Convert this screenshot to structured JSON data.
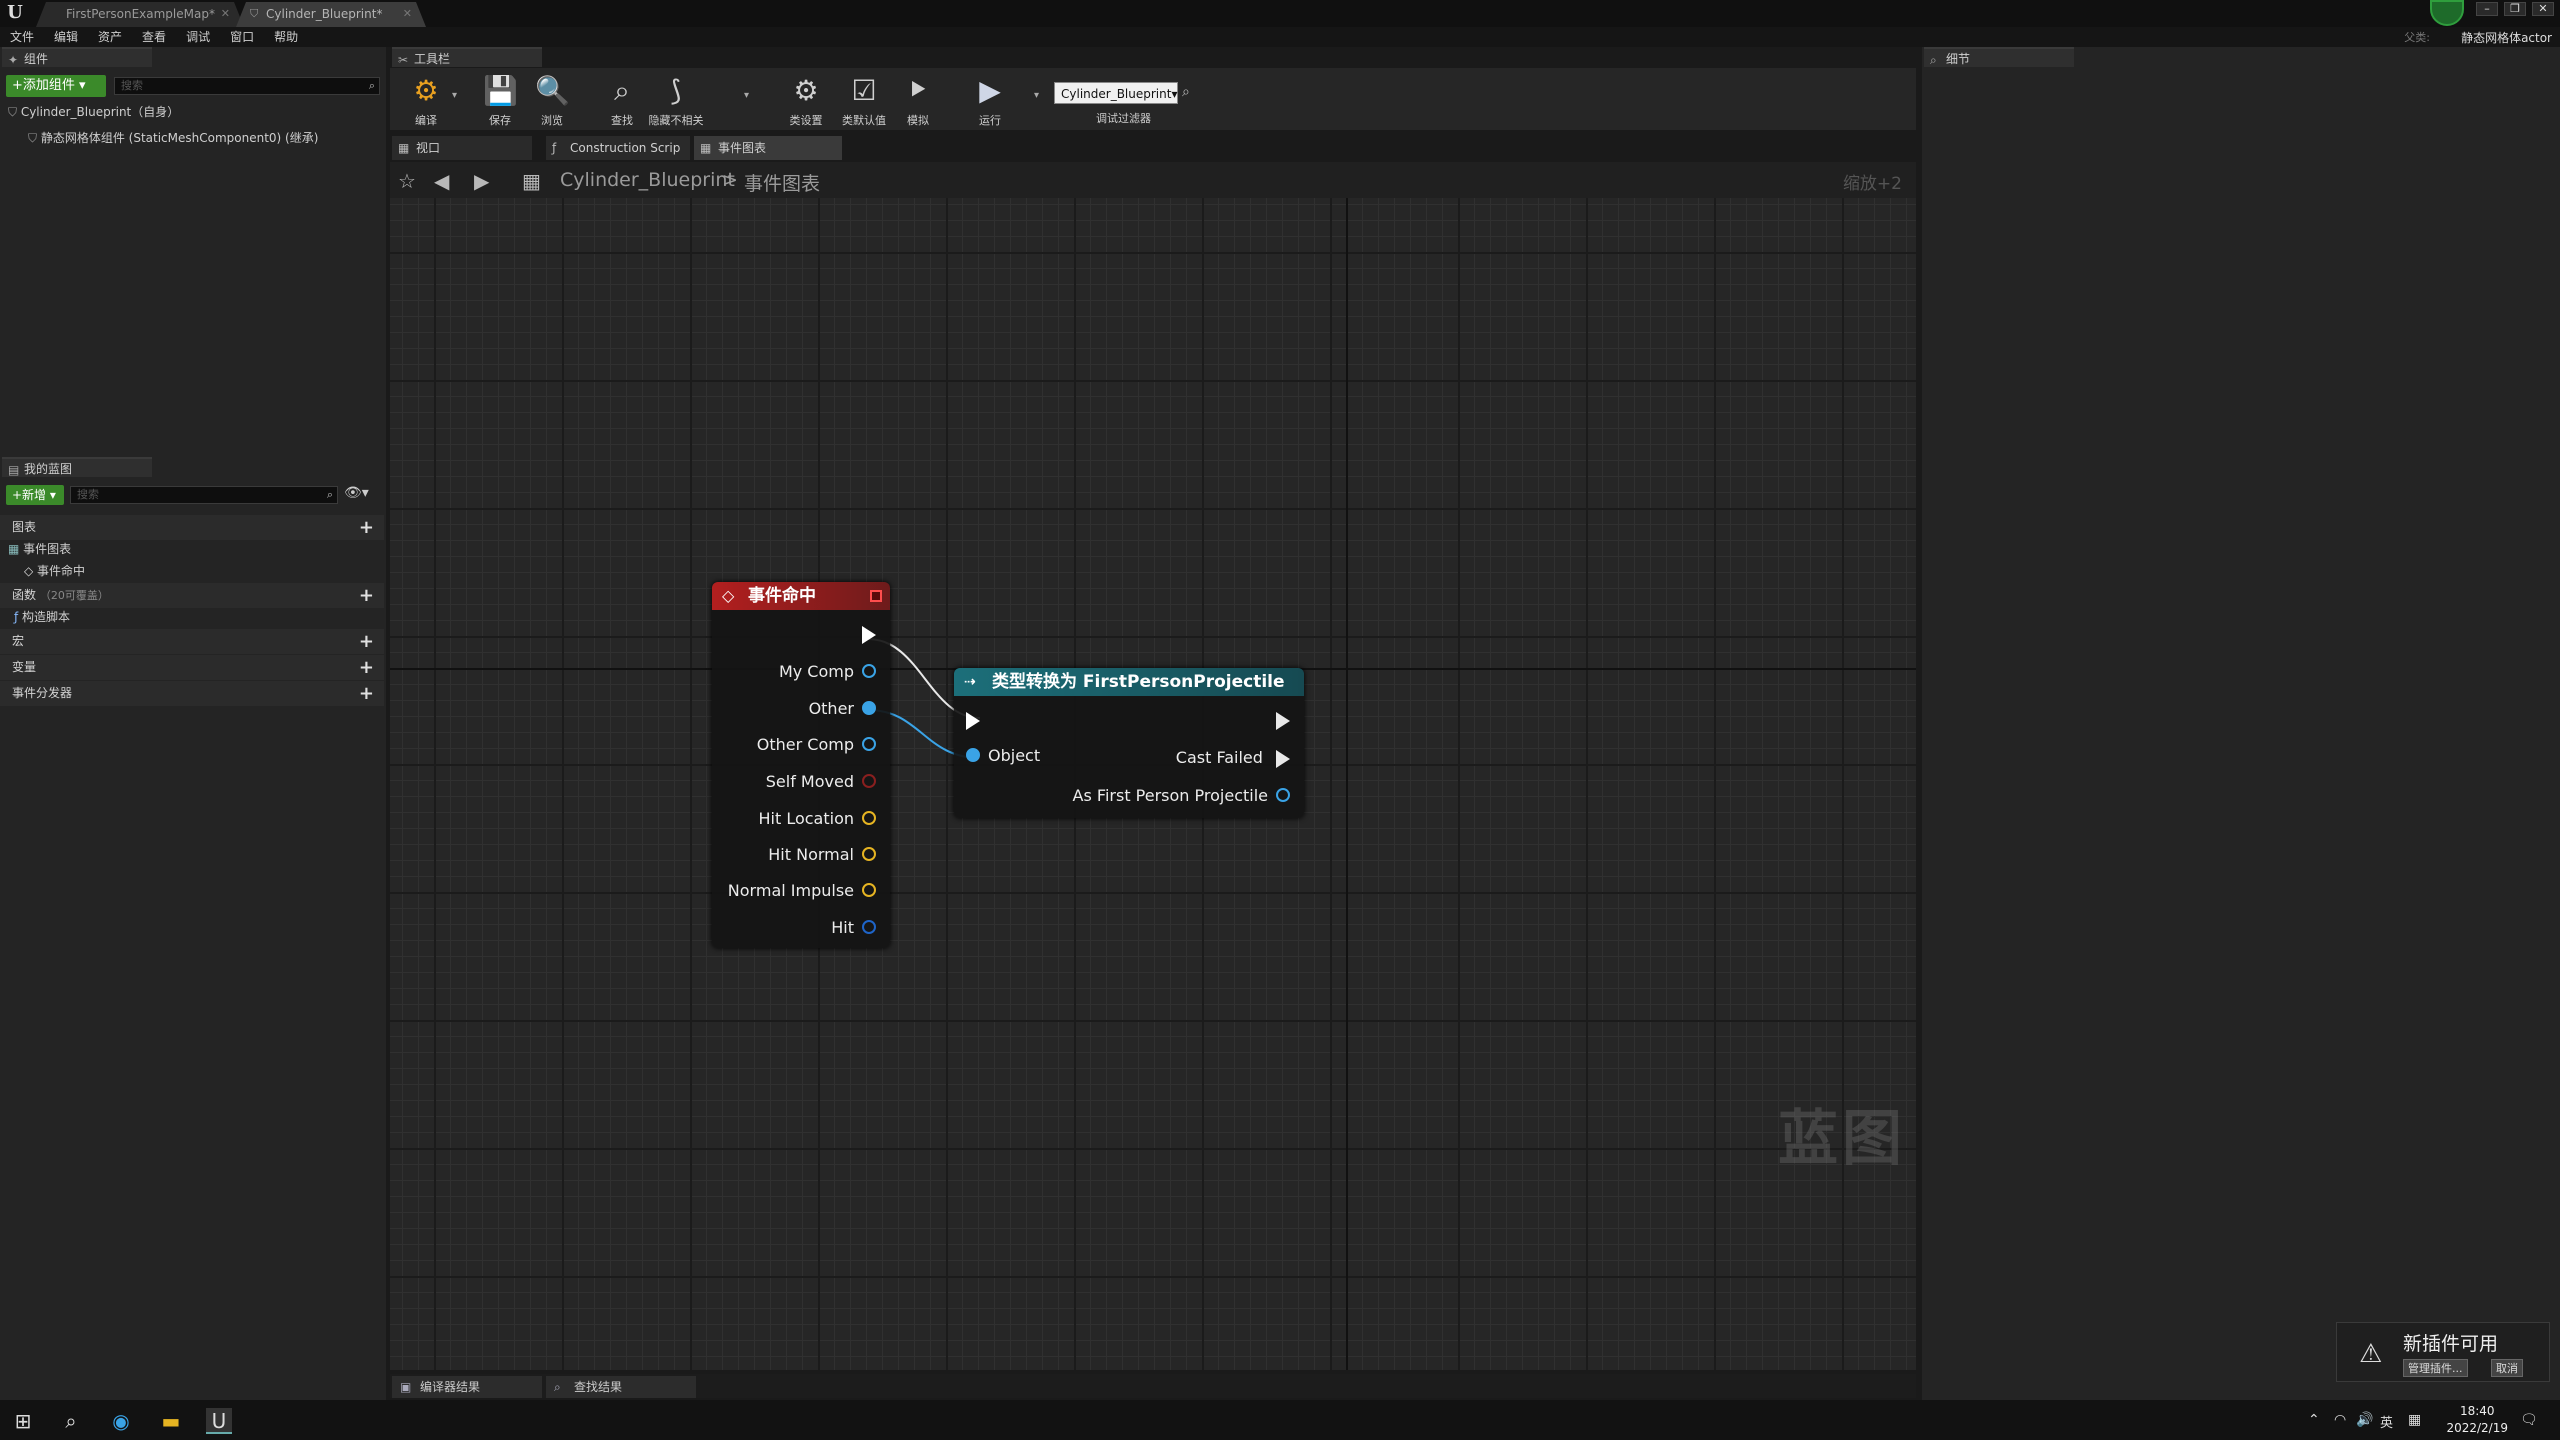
{
  "titlebar": {
    "tabs": [
      {
        "label": "FirstPersonExampleMap*",
        "active": false
      },
      {
        "label": "Cylinder_Blueprint*",
        "active": true
      }
    ]
  },
  "menu": [
    "文件",
    "编辑",
    "资产",
    "查看",
    "调试",
    "窗口",
    "帮助"
  ],
  "context_label": "静态网格体actor",
  "context_small": "父类:",
  "components_panel": {
    "tab": "组件",
    "add_button": "+添加组件 ▾",
    "search_placeholder": "搜索",
    "root": "Cylinder_Blueprint（自身）",
    "child": "静态网格体组件 (StaticMeshComponent0) (继承)"
  },
  "my_blueprint_panel": {
    "tab": "我的蓝图",
    "new_button": "+新增 ▾",
    "search_placeholder": "搜索",
    "graphs_section": "图表",
    "event_graph": "事件图表",
    "event_hit": "事件命中",
    "functions_section": "函数",
    "functions_note": "（20可覆盖）",
    "construction_script": "构造脚本",
    "macros_section": "宏",
    "variables_section": "变量",
    "dispatchers_section": "事件分发器"
  },
  "toolbar": {
    "tab": "工具栏",
    "buttons": [
      "编译",
      "保存",
      "浏览",
      "查找",
      "隐藏不相关",
      "类设置",
      "类默认值",
      "模拟",
      "运行"
    ],
    "debug_object": "Cylinder_Blueprint▾",
    "debug_filter_label": "调试过滤器"
  },
  "graph_tabs": [
    "视口",
    "Construction Scrip",
    "事件图表"
  ],
  "breadcrumb": {
    "blueprint": "Cylinder_Blueprint",
    "separator": ">",
    "graph": "事件图表",
    "zoom": "缩放+2"
  },
  "event_node": {
    "title": "事件命中",
    "pins": [
      {
        "label": "My Comp",
        "color": "#3aa3e6",
        "filled": false
      },
      {
        "label": "Other",
        "color": "#3aa3e6",
        "filled": true
      },
      {
        "label": "Other Comp",
        "color": "#3aa3e6",
        "filled": false
      },
      {
        "label": "Self Moved",
        "color": "#8a1f1f",
        "filled": false
      },
      {
        "label": "Hit Location",
        "color": "#e6b422",
        "filled": false
      },
      {
        "label": "Hit Normal",
        "color": "#e6b422",
        "filled": false
      },
      {
        "label": "Normal Impulse",
        "color": "#e6b422",
        "filled": false
      },
      {
        "label": "Hit",
        "color": "#1e64c8",
        "filled": false
      }
    ],
    "header_color": "#b31f1f"
  },
  "cast_node": {
    "title": "类型转换为 FirstPersonProjectile",
    "object_label": "Object",
    "cast_failed_label": "Cast Failed",
    "output_label": "As First Person Projectile",
    "header_color": "#1c6f7a"
  },
  "watermark": "蓝图",
  "details_panel": {
    "tab": "细节"
  },
  "bottom_tabs": [
    "编译器结果",
    "查找结果"
  ],
  "notification": {
    "title": "新插件可用",
    "manage": "管理插件...",
    "cancel": "取消"
  },
  "taskbar": {
    "time": "18:40",
    "date": "2022/2/19",
    "ime": "英"
  }
}
